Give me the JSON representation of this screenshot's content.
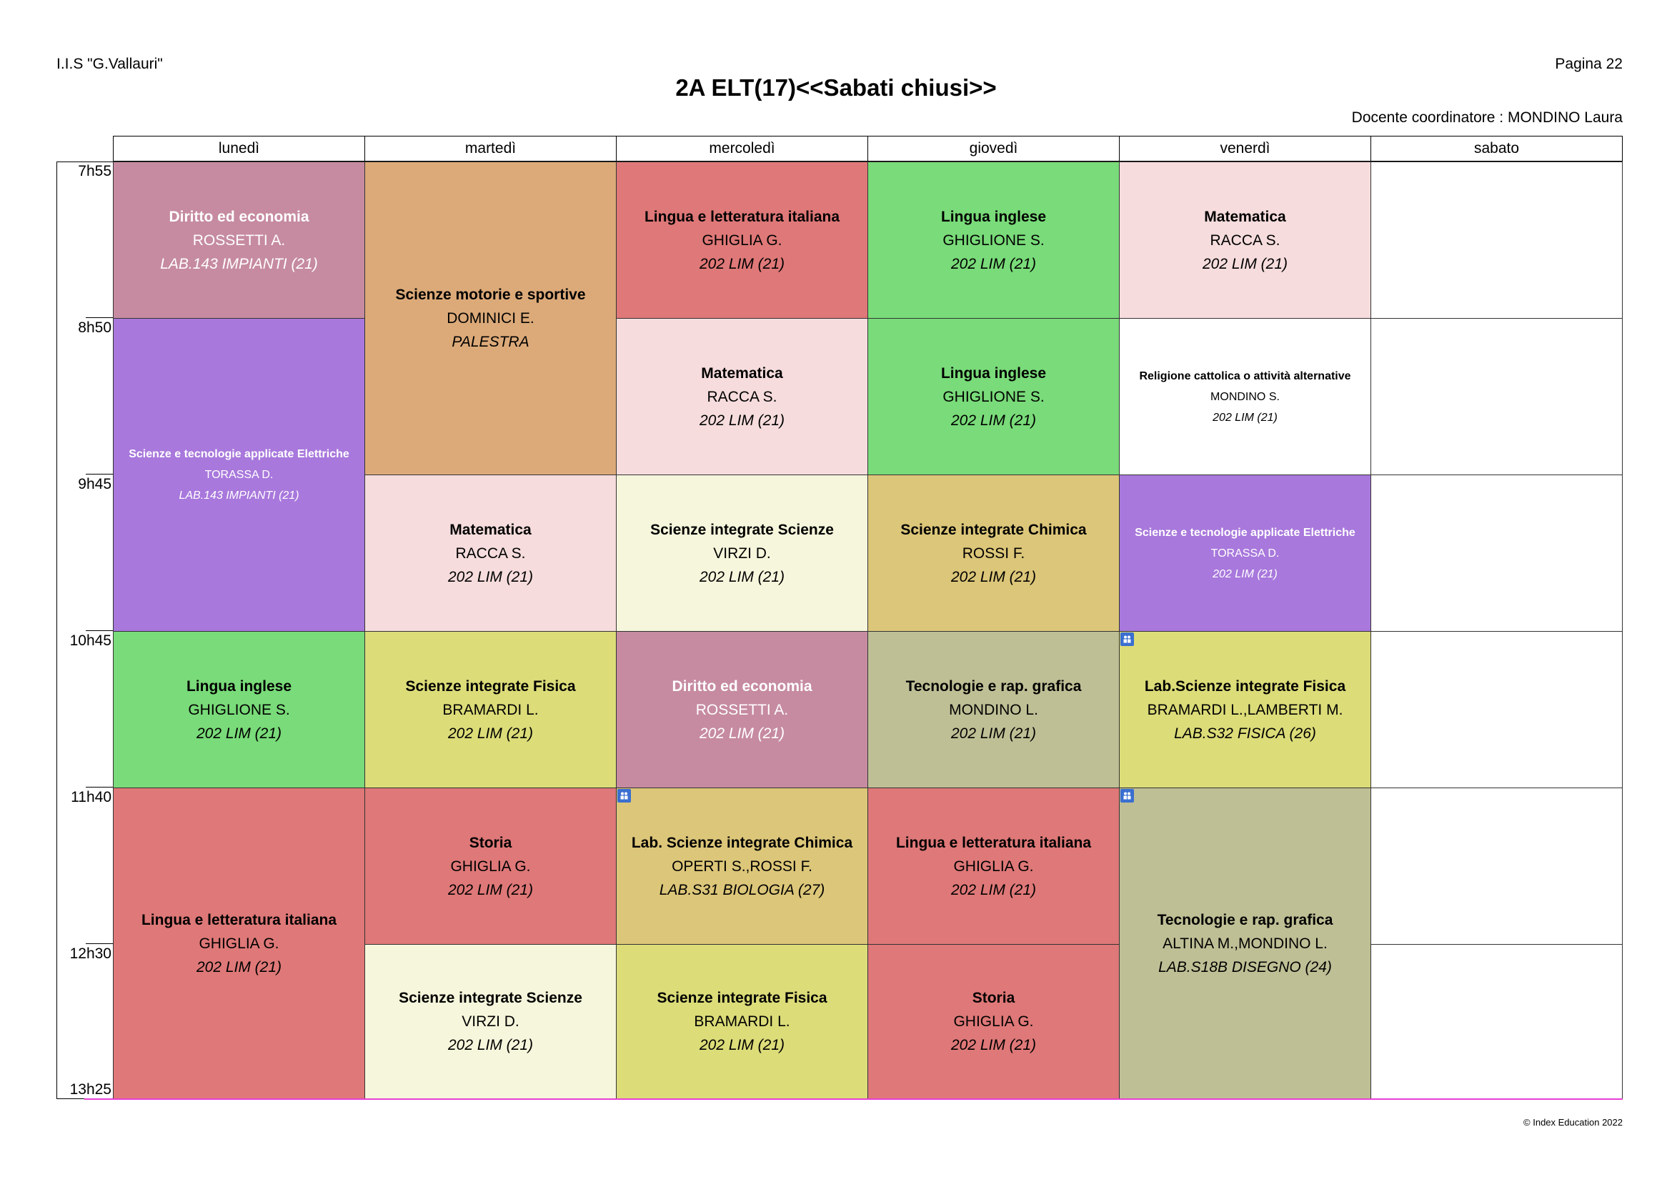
{
  "header": {
    "school": "I.I.S \"G.Vallauri\"",
    "page": "Pagina 22",
    "title": "2A ELT(17)<<Sabati chiusi>>",
    "coordinator": "Docente coordinatore : MONDINO Laura"
  },
  "days": [
    "lunedì",
    "martedì",
    "mercoledì",
    "giovedì",
    "venerdì",
    "sabato"
  ],
  "times": [
    "7h55",
    "8h50",
    "9h45",
    "10h45",
    "11h40",
    "12h30",
    "13h25"
  ],
  "lessons": {
    "mon1": {
      "subject": "Diritto ed economia",
      "teacher": "ROSSETTI A.",
      "room": "LAB.143 IMPIANTI (21)"
    },
    "mon2": {
      "subject": "Scienze e tecnologie applicate Elettriche",
      "teacher": "TORASSA D.",
      "room": "LAB.143 IMPIANTI (21)"
    },
    "mon3": {
      "subject": "Lingua inglese",
      "teacher": "GHIGLIONE S.",
      "room": "202 LIM (21)"
    },
    "mon4": {
      "subject": "Lingua e letteratura italiana",
      "teacher": "GHIGLIA G.",
      "room": "202 LIM (21)"
    },
    "tue1": {
      "subject": "Scienze motorie e sportive",
      "teacher": "DOMINICI E.",
      "room": "PALESTRA"
    },
    "tue2": {
      "subject": "Matematica",
      "teacher": "RACCA S.",
      "room": "202 LIM (21)"
    },
    "tue3": {
      "subject": "Scienze integrate Fisica",
      "teacher": "BRAMARDI L.",
      "room": "202 LIM (21)"
    },
    "tue4": {
      "subject": "Storia",
      "teacher": "GHIGLIA G.",
      "room": "202 LIM (21)"
    },
    "tue5": {
      "subject": "Scienze integrate Scienze",
      "teacher": "VIRZI D.",
      "room": "202 LIM (21)"
    },
    "wed1": {
      "subject": "Lingua e letteratura italiana",
      "teacher": "GHIGLIA G.",
      "room": "202 LIM (21)"
    },
    "wed2": {
      "subject": "Matematica",
      "teacher": "RACCA S.",
      "room": "202 LIM (21)"
    },
    "wed3": {
      "subject": "Scienze integrate Scienze",
      "teacher": "VIRZI D.",
      "room": "202 LIM (21)"
    },
    "wed4": {
      "subject": "Diritto ed economia",
      "teacher": "ROSSETTI A.",
      "room": "202 LIM (21)"
    },
    "wed5": {
      "subject": "Lab. Scienze integrate Chimica",
      "teacher": "OPERTI S.,ROSSI F.",
      "room": "LAB.S31 BIOLOGIA (27)"
    },
    "wed6": {
      "subject": "Scienze integrate Fisica",
      "teacher": "BRAMARDI L.",
      "room": "202 LIM (21)"
    },
    "thu1": {
      "subject": "Lingua inglese",
      "teacher": "GHIGLIONE S.",
      "room": "202 LIM (21)"
    },
    "thu2": {
      "subject": "Lingua inglese",
      "teacher": "GHIGLIONE S.",
      "room": "202 LIM (21)"
    },
    "thu3": {
      "subject": "Scienze integrate Chimica",
      "teacher": "ROSSI F.",
      "room": "202 LIM (21)"
    },
    "thu4": {
      "subject": "Tecnologie  e rap. grafica",
      "teacher": "MONDINO L.",
      "room": "202 LIM (21)"
    },
    "thu5": {
      "subject": "Lingua e letteratura italiana",
      "teacher": "GHIGLIA G.",
      "room": "202 LIM (21)"
    },
    "thu6": {
      "subject": "Storia",
      "teacher": "GHIGLIA G.",
      "room": "202 LIM (21)"
    },
    "fri1": {
      "subject": "Matematica",
      "teacher": "RACCA S.",
      "room": "202 LIM (21)"
    },
    "fri2": {
      "subject": "Religione cattolica o attività alternative",
      "teacher": "MONDINO S.",
      "room": "202 LIM (21)"
    },
    "fri3": {
      "subject": "Scienze e tecnologie applicate Elettriche",
      "teacher": "TORASSA D.",
      "room": "202 LIM (21)"
    },
    "fri4": {
      "subject": "Lab.Scienze integrate Fisica",
      "teacher": "BRAMARDI L.,LAMBERTI M.",
      "room": "LAB.S32 FISICA (26)"
    },
    "fri5": {
      "subject": "Tecnologie  e rap. grafica",
      "teacher": "ALTINA M.,MONDINO L.",
      "room": "LAB.S18B DISEGNO (24)"
    }
  },
  "colors": {
    "diritto": "#c68ba0",
    "sta": "#a878dc",
    "inglese": "#79db79",
    "italiano": "#df7878",
    "motorie": "#dcaa79",
    "matematica": "#f6dcdc",
    "fisica": "#dcdc79",
    "scienze": "#f6f6dc",
    "chimica": "#dcc679",
    "tecnologie": "#bfbf96",
    "religione": "#ffffff"
  },
  "footer": {
    "copyright": "© Index Education 2022"
  }
}
